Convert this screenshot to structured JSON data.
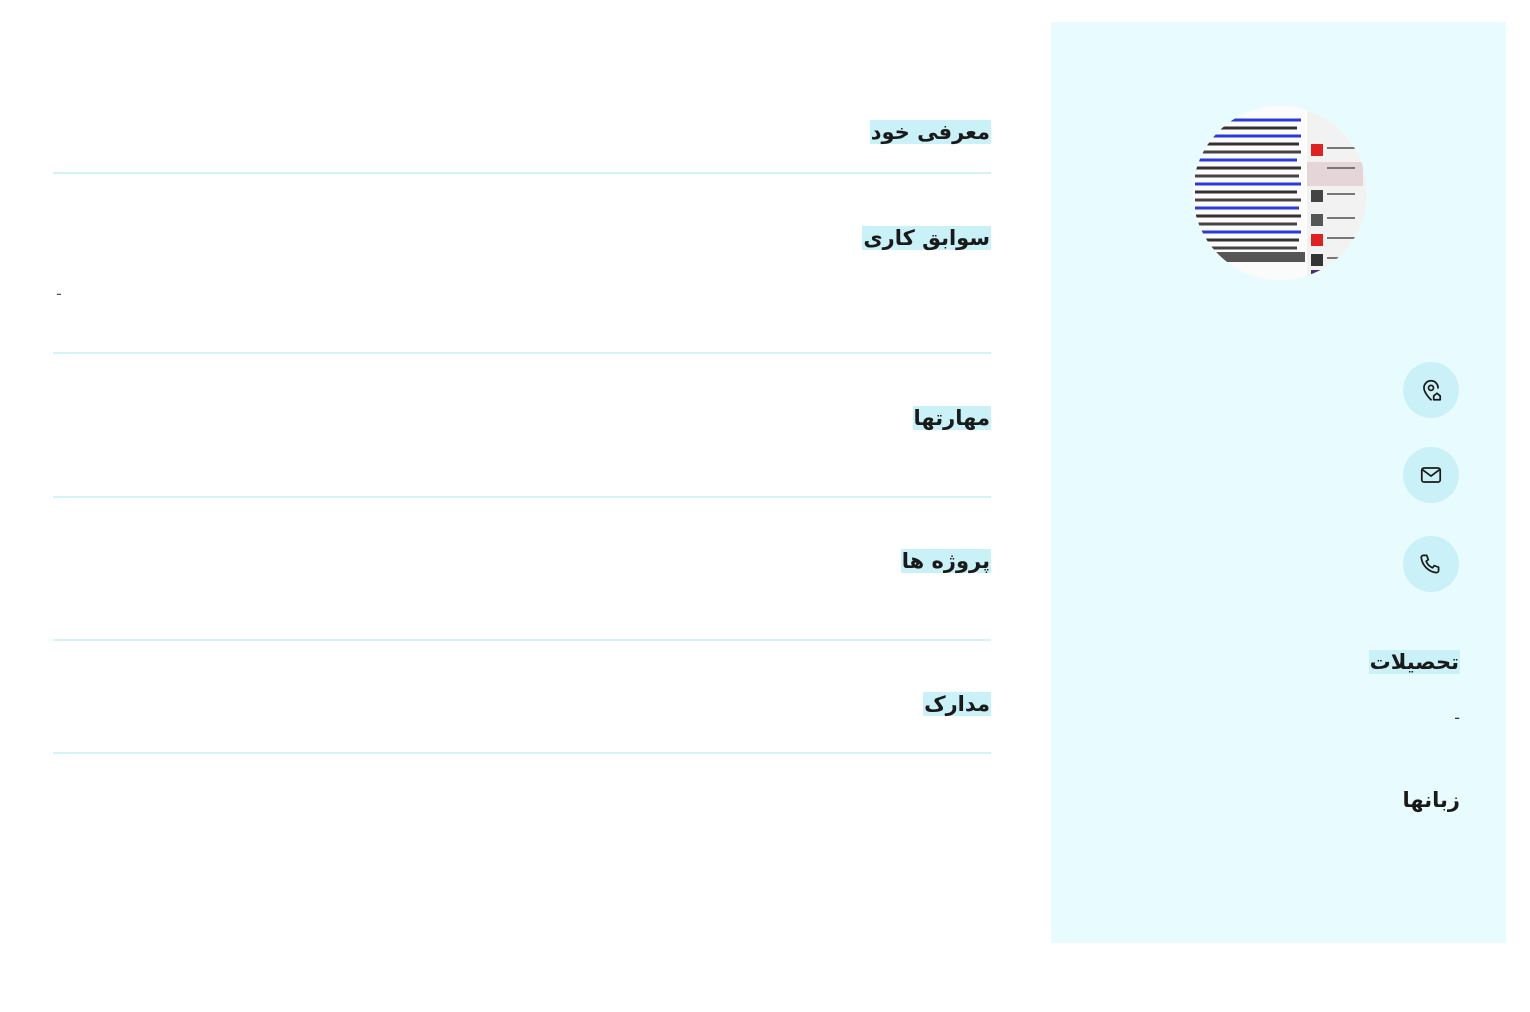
{
  "main": {
    "sections": [
      {
        "title": "معرفی خود"
      },
      {
        "title": "سوابق کاری",
        "value": "-"
      },
      {
        "title": "مهارتها"
      },
      {
        "title": "پروژه ها"
      },
      {
        "title": "مدارک"
      }
    ]
  },
  "sidebar": {
    "avatar_alt": "profile photo",
    "contacts": [
      {
        "icon": "location-home-icon"
      },
      {
        "icon": "mail-icon"
      },
      {
        "icon": "phone-icon"
      }
    ],
    "education": {
      "title": "تحصیلات",
      "value": "-"
    },
    "languages": {
      "title": "زبانها"
    }
  },
  "colors": {
    "sidebar_bg": "#e8fbfe",
    "accent": "#c9f1f7",
    "divider": "#d2f3f8"
  }
}
